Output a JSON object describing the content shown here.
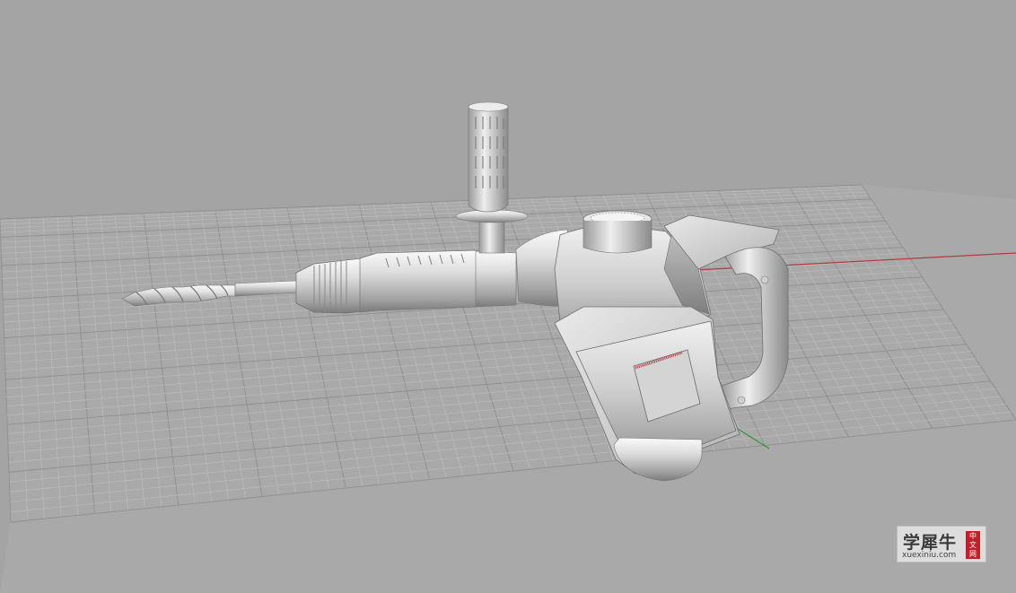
{
  "viewport": {
    "background": "#a4a4a4",
    "grid_color": "#bdbdbd",
    "grid_major_color": "#8f8f8f",
    "x_axis_color": "#b83a3a",
    "y_axis_color": "#2f9a2f"
  },
  "model": {
    "object": "hammer-drill",
    "shading": "#d6d6d6"
  },
  "watermark": {
    "title": "学犀牛",
    "url": "xuexiniu.com",
    "badge": [
      "中",
      "文",
      "网"
    ],
    "badge_color": "#c0202a"
  }
}
